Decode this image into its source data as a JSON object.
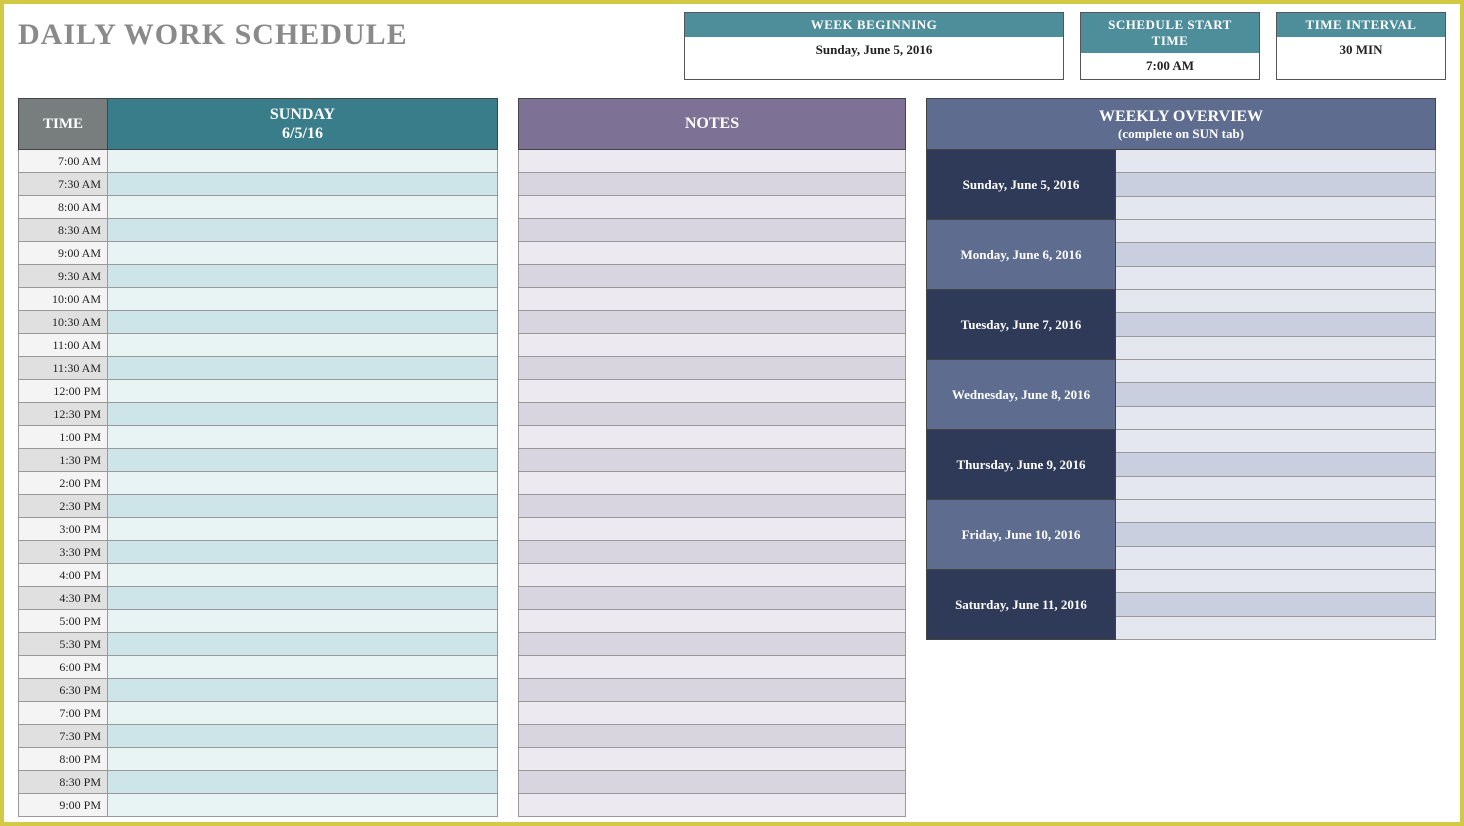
{
  "title": "DAILY WORK SCHEDULE",
  "info": {
    "week_label": "WEEK BEGINNING",
    "week_value": "Sunday, June 5, 2016",
    "start_label": "SCHEDULE START TIME",
    "start_value": "7:00 AM",
    "interval_label": "TIME INTERVAL",
    "interval_value": "30 MIN"
  },
  "schedule": {
    "time_header": "TIME",
    "day_name": "SUNDAY",
    "day_date": "6/5/16",
    "times": [
      "7:00 AM",
      "7:30 AM",
      "8:00 AM",
      "8:30 AM",
      "9:00 AM",
      "9:30 AM",
      "10:00 AM",
      "10:30 AM",
      "11:00 AM",
      "11:30 AM",
      "12:00 PM",
      "12:30 PM",
      "1:00 PM",
      "1:30 PM",
      "2:00 PM",
      "2:30 PM",
      "3:00 PM",
      "3:30 PM",
      "4:00 PM",
      "4:30 PM",
      "5:00 PM",
      "5:30 PM",
      "6:00 PM",
      "6:30 PM",
      "7:00 PM",
      "7:30 PM",
      "8:00 PM",
      "8:30 PM",
      "9:00 PM"
    ]
  },
  "notes": {
    "header": "NOTES",
    "row_count": 29
  },
  "overview": {
    "header_title": "WEEKLY OVERVIEW",
    "header_sub": "(complete on SUN tab)",
    "days": [
      "Sunday, June 5, 2016",
      "Monday, June 6, 2016",
      "Tuesday, June 7, 2016",
      "Wednesday, June 8, 2016",
      "Thursday, June 9, 2016",
      "Friday, June 10, 2016",
      "Saturday, June 11, 2016"
    ]
  }
}
